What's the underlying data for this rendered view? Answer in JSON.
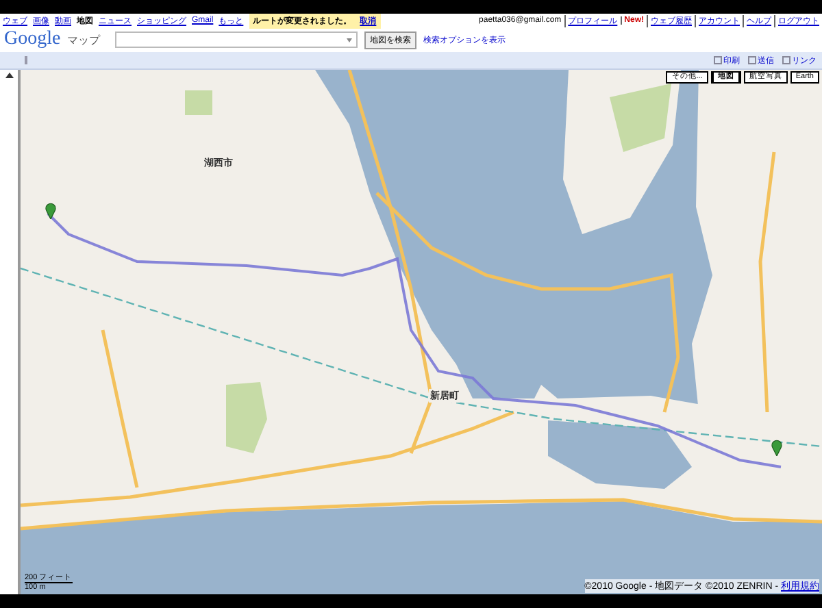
{
  "top_nav": {
    "links": [
      {
        "label": "ウェブ",
        "selected": false
      },
      {
        "label": "画像",
        "selected": false
      },
      {
        "label": "動画",
        "selected": false
      },
      {
        "label": "地図",
        "selected": true
      },
      {
        "label": "ニュース",
        "selected": false
      },
      {
        "label": "ショッピング",
        "selected": false
      },
      {
        "label": "Gmail",
        "selected": false
      },
      {
        "label": "もっと",
        "selected": false
      }
    ],
    "notice": {
      "text": "ルートが変更されました。",
      "link": "取消"
    },
    "account": {
      "email": "paetta036@gmail.com",
      "links": [
        {
          "label": "プロフィール",
          "kind": "link"
        },
        {
          "label": "New!",
          "kind": "badge"
        },
        {
          "label": "ウェブ履歴",
          "kind": "link"
        },
        {
          "label": "アカウント",
          "kind": "link"
        },
        {
          "label": "ヘルプ",
          "kind": "link"
        },
        {
          "label": "ログアウト",
          "kind": "link"
        }
      ]
    }
  },
  "search": {
    "logo": "Google",
    "product": "マップ",
    "button": "地図を検索",
    "options_link": "検索オプションを表示"
  },
  "toolbar": [
    "印刷",
    "送信",
    "リンク"
  ],
  "map_types": [
    {
      "label": "その他...",
      "selected": false
    },
    {
      "label": "地図",
      "selected": true
    },
    {
      "label": "航空写真",
      "selected": false
    },
    {
      "label": "Earth",
      "selected": false
    }
  ],
  "map_labels": [
    {
      "text": "湖西市"
    },
    {
      "text": "新居町"
    }
  ],
  "scale": {
    "imperial": "200 フィート",
    "metric": "100 m"
  },
  "copyright": {
    "text": "©2010 Google - 地図データ ©2010 ZENRIN - ",
    "link": "利用規約"
  }
}
